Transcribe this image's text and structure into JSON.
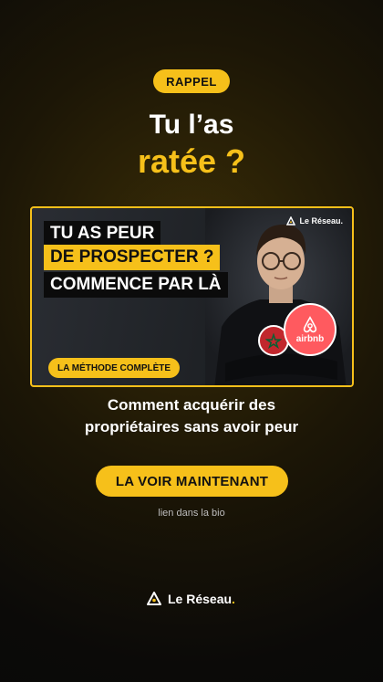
{
  "reminder_badge": "RAPPEL",
  "headline": {
    "line1": "Tu l’as",
    "line2": "ratée ?"
  },
  "thumbnail": {
    "line1": "TU AS PEUR",
    "line2": "DE PROSPECTER ?",
    "line3": "COMMENCE PAR LÀ",
    "method_pill": "LA MÉTHODE COMPLÈTE",
    "brand": "Le Réseau.",
    "airbnb_label": "airbnb"
  },
  "subtitle": {
    "line1": "Comment acquérir des",
    "line2": "propriétaires sans avoir peur"
  },
  "cta_label": "LA VOIR MAINTENANT",
  "bio_note": "lien dans la bio",
  "footer_brand": {
    "name": "Le Réseau",
    "dot": "."
  },
  "colors": {
    "accent": "#f6c01a",
    "airbnb": "#ff5a5f",
    "morocco_red": "#c1272d",
    "morocco_green": "#006233"
  }
}
